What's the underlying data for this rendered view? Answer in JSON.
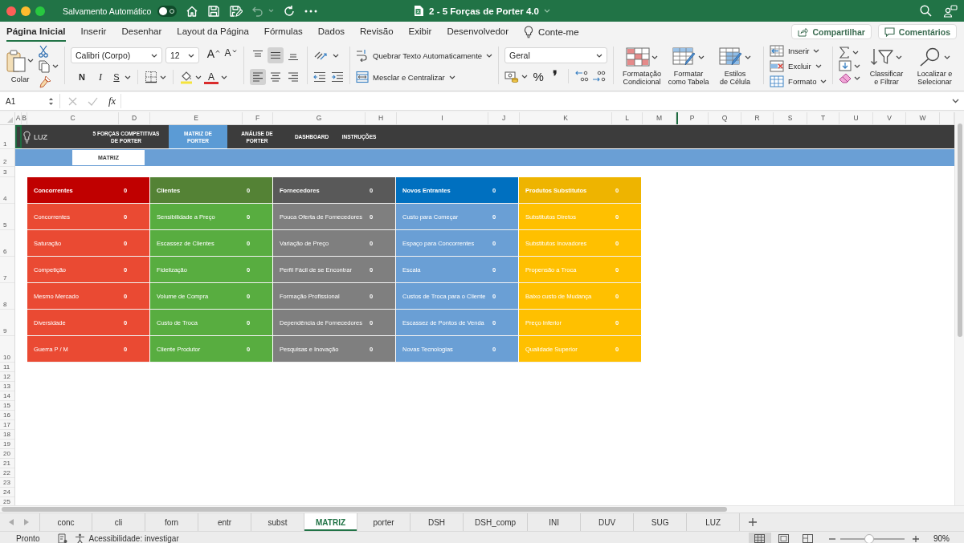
{
  "title_bar": {
    "autosave_label": "Salvamento Automático",
    "autosave_on": false,
    "undo_disabled": true,
    "document_title": "2 - 5 Forças de Porter 4.0"
  },
  "ribbon_tabs": [
    {
      "label": "Página Inicial",
      "selected": true
    },
    {
      "label": "Inserir",
      "selected": false
    },
    {
      "label": "Desenhar",
      "selected": false
    },
    {
      "label": "Layout da Página",
      "selected": false
    },
    {
      "label": "Fórmulas",
      "selected": false
    },
    {
      "label": "Dados",
      "selected": false
    },
    {
      "label": "Revisão",
      "selected": false
    },
    {
      "label": "Exibir",
      "selected": false
    },
    {
      "label": "Desenvolvedor",
      "selected": false
    }
  ],
  "tell_me": "Conte-me",
  "share_button": "Compartilhar",
  "comments_button": "Comentários",
  "ribbon": {
    "paste_label": "Colar",
    "font_name": "Calibri (Corpo)",
    "font_size": "12",
    "grow_font_key": "A",
    "shrink_font_key": "A",
    "bold_key": "N",
    "italic_key": "I",
    "underline_key": "S",
    "font_color_key": "A",
    "vertical_align": [
      {
        "kind": "top",
        "selected": false
      },
      {
        "kind": "middle",
        "selected": true
      },
      {
        "kind": "bottom",
        "selected": false
      }
    ],
    "horizontal_align": [
      {
        "kind": "left",
        "selected": true
      },
      {
        "kind": "center",
        "selected": false
      },
      {
        "kind": "right",
        "selected": false
      }
    ],
    "wrap_text": "Quebrar Texto Automaticamente",
    "merge_center": "Mesclar e Centralizar",
    "number_format": "Geral",
    "percent_key": "%",
    "comma_key": "❜",
    "style_buttons": [
      {
        "kind": "conditional",
        "label": "Formatação\nCondicional"
      },
      {
        "kind": "table",
        "label": "Formatar\ncomo Tabela"
      },
      {
        "kind": "styles",
        "label": "Estilos\nde Célula"
      }
    ],
    "cell_buttons": [
      {
        "kind": "insert",
        "label": "Inserir"
      },
      {
        "kind": "delete",
        "label": "Excluir"
      },
      {
        "kind": "format",
        "label": "Formato"
      }
    ],
    "editing_buttons": [
      {
        "kind": "sort",
        "label": "Classificar\ne Filtrar"
      },
      {
        "kind": "find",
        "label": "Localizar e\nSelecionar"
      }
    ]
  },
  "formula_bar": {
    "name_box": "A1",
    "function_label": "fx"
  },
  "column_headers": [
    "A",
    "B",
    "C",
    "D",
    "E",
    "F",
    "G",
    "H",
    "I",
    "J",
    "K",
    "L",
    "M",
    "P",
    "Q",
    "R",
    "S",
    "T",
    "U",
    "V",
    "W"
  ],
  "row_headers": [
    "1",
    "2",
    "3",
    "4",
    "5",
    "6",
    "7",
    "8",
    "9",
    "10",
    "11",
    "12",
    "13",
    "14",
    "15",
    "16",
    "17",
    "18",
    "19",
    "20",
    "21",
    "22",
    "23",
    "24",
    "25"
  ],
  "sheet_header": {
    "logo_text": "LUZ",
    "nav": [
      {
        "label": "5 FORÇAS COMPETITIVAS DE PORTER",
        "selected": false
      },
      {
        "label": "MATRIZ DE PORTER",
        "selected": true
      },
      {
        "label": "ANÁLISE DE PORTER",
        "selected": false
      },
      {
        "label": "DASHBOARD",
        "selected": false
      },
      {
        "label": "INSTRUÇÕES",
        "selected": false
      }
    ],
    "sub_tab": "MATRIZ"
  },
  "forces": [
    {
      "header": {
        "title": "Concorrentes",
        "total": "0",
        "color": "#c00000"
      },
      "color": "#ea4a33",
      "items": [
        {
          "label": "Concorrentes",
          "value": "0"
        },
        {
          "label": "Saturação",
          "value": "0"
        },
        {
          "label": "Competição",
          "value": "0"
        },
        {
          "label": "Mesmo Mercado",
          "value": "0"
        },
        {
          "label": "Diversidade",
          "value": "0"
        },
        {
          "label": "Guerra P / M",
          "value": "0"
        }
      ]
    },
    {
      "header": {
        "title": "Clientes",
        "total": "0",
        "color": "#548235"
      },
      "color": "#58ad40",
      "items": [
        {
          "label": "Sensibilidade a Preço",
          "value": "0"
        },
        {
          "label": "Escassez de Clientes",
          "value": "0"
        },
        {
          "label": "Fidelização",
          "value": "0"
        },
        {
          "label": "Volume de Compra",
          "value": "0"
        },
        {
          "label": "Custo de Troca",
          "value": "0"
        },
        {
          "label": "Cliente Produtor",
          "value": "0"
        }
      ]
    },
    {
      "header": {
        "title": "Fornecedores",
        "total": "0",
        "color": "#595959"
      },
      "color": "#7f7f7f",
      "items": [
        {
          "label": "Pouca Oferta de Fornecedores",
          "value": "0"
        },
        {
          "label": "Variação de Preço",
          "value": "0"
        },
        {
          "label": "Perfil Fácil de se Encontrar",
          "value": "0"
        },
        {
          "label": "Formação Profissional",
          "value": "0"
        },
        {
          "label": "Dependência de Fornecedores",
          "value": "0"
        },
        {
          "label": "Pesquisas e Inovação",
          "value": "0"
        }
      ]
    },
    {
      "header": {
        "title": "Novos Entrantes",
        "total": "0",
        "color": "#0070c0"
      },
      "color": "#6a9fd5",
      "items": [
        {
          "label": "Custo para Começar",
          "value": "0"
        },
        {
          "label": "Espaço para Concorrentes",
          "value": "0"
        },
        {
          "label": "Escala",
          "value": "0"
        },
        {
          "label": "Custos de Troca para o Cliente",
          "value": "0"
        },
        {
          "label": "Escassez de Pontos de Venda",
          "value": "0"
        },
        {
          "label": "Novas Tecnologias",
          "value": "0"
        }
      ]
    },
    {
      "header": {
        "title": "Produtos Substitutos",
        "total": "0",
        "color": "#eeb400"
      },
      "color": "#ffc000",
      "items": [
        {
          "label": "Substitutos Diretos",
          "value": "0"
        },
        {
          "label": "Substitutos Inovadores",
          "value": "0"
        },
        {
          "label": "Propensão a Troca",
          "value": "0"
        },
        {
          "label": "Baixo custo de Mudança",
          "value": "0"
        },
        {
          "label": "Preço Inferior",
          "value": "0"
        },
        {
          "label": "Qualidade Superior",
          "value": "0"
        }
      ]
    }
  ],
  "sheet_tabs": [
    {
      "label": "conc",
      "selected": false
    },
    {
      "label": "cli",
      "selected": false
    },
    {
      "label": "forn",
      "selected": false
    },
    {
      "label": "entr",
      "selected": false
    },
    {
      "label": "subst",
      "selected": false
    },
    {
      "label": "MATRIZ",
      "selected": true
    },
    {
      "label": "porter",
      "selected": false
    },
    {
      "label": "DSH",
      "selected": false
    },
    {
      "label": "DSH_comp",
      "selected": false
    },
    {
      "label": "INI",
      "selected": false
    },
    {
      "label": "DUV",
      "selected": false
    },
    {
      "label": "SUG",
      "selected": false
    },
    {
      "label": "LUZ",
      "selected": false
    }
  ],
  "status_bar": {
    "status": "Pronto",
    "accessibility": "Acessibilidade: investigar",
    "views": [
      {
        "kind": "normal",
        "selected": true
      },
      {
        "kind": "page_layout",
        "selected": false
      },
      {
        "kind": "page_break",
        "selected": false
      }
    ],
    "zoom_slider": {
      "level": 0.45
    },
    "zoom": "90%"
  }
}
